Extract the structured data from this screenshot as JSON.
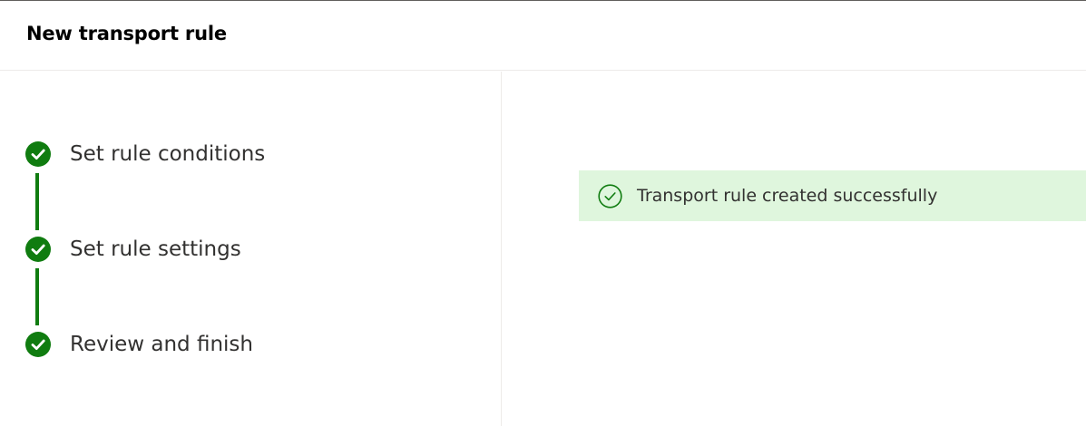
{
  "panel": {
    "title": "New transport rule"
  },
  "steps": [
    {
      "label": "Set rule conditions",
      "status": "completed"
    },
    {
      "label": "Set rule settings",
      "status": "completed"
    },
    {
      "label": "Review and finish",
      "status": "completed"
    }
  ],
  "notification": {
    "message": "Transport rule created successfully",
    "icon": "checkmark-circle-icon",
    "type": "success"
  },
  "colors": {
    "success_green": "#107c10",
    "banner_background": "#dff6dd"
  }
}
